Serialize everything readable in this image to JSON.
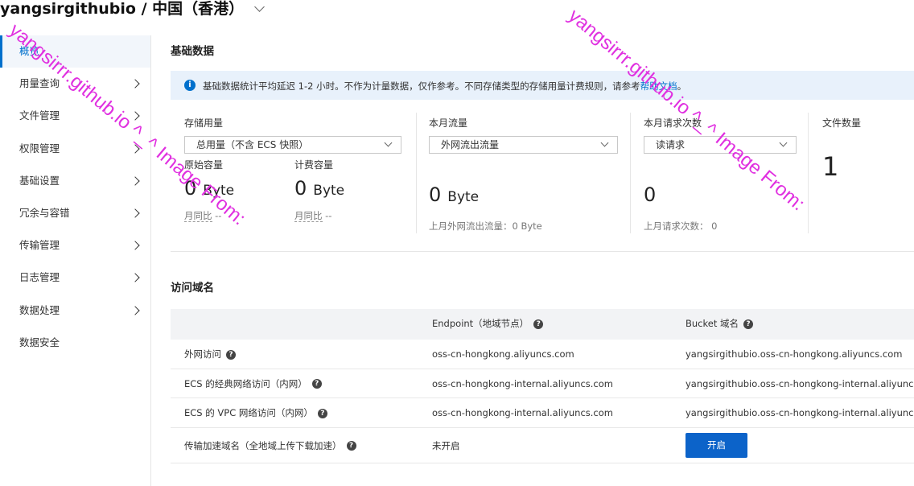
{
  "header": {
    "bucket": "yangsirgithubio",
    "region": "中国（香港）",
    "separator": " / "
  },
  "sidebar": {
    "items": [
      {
        "label": "概览",
        "active": true,
        "has_arrow": false
      },
      {
        "label": "用量查询",
        "has_arrow": true
      },
      {
        "label": "文件管理",
        "has_arrow": true
      },
      {
        "label": "权限管理",
        "has_arrow": true
      },
      {
        "label": "基础设置",
        "has_arrow": true
      },
      {
        "label": "冗余与容错",
        "has_arrow": true
      },
      {
        "label": "传输管理",
        "has_arrow": true
      },
      {
        "label": "日志管理",
        "has_arrow": true
      },
      {
        "label": "数据处理",
        "has_arrow": true
      },
      {
        "label": "数据安全",
        "has_arrow": false
      }
    ]
  },
  "basic": {
    "title": "基础数据",
    "info": {
      "text": "基础数据统计平均延迟 1-2 小时。不作为计量数据，仅作参考。不同存储类型的存储用量计费规则，请参考",
      "link": "帮助文档",
      "suffix": "。"
    },
    "storage": {
      "label": "存储用量",
      "select": "总用量（不含 ECS 快照）",
      "raw_label": "原始容量",
      "raw_value": "0",
      "raw_unit": "Byte",
      "raw_compare": "月同比",
      "raw_compare_value": "--",
      "billing_label": "计费容量",
      "billing_value": "0",
      "billing_unit": "Byte",
      "billing_compare": "月同比",
      "billing_compare_value": "--"
    },
    "traffic": {
      "label": "本月流量",
      "select": "外网流出流量",
      "value": "0",
      "unit": "Byte",
      "last_month": "上月外网流出流量：0 Byte"
    },
    "requests": {
      "label": "本月请求次数",
      "select": "读请求",
      "value": "0",
      "last_month": "上月请求次数： 0"
    },
    "files": {
      "label": "文件数量",
      "value": "1"
    }
  },
  "domains": {
    "title": "访问域名",
    "headers": [
      "",
      "Endpoint（地域节点）",
      "Bucket 域名"
    ],
    "rows": [
      {
        "name": "外网访问",
        "endpoint": "oss-cn-hongkong.aliyuncs.com",
        "bucket_domain": "yangsirgithubio.oss-cn-hongkong.aliyuncs.com"
      },
      {
        "name": "ECS 的经典网络访问（内网）",
        "endpoint": "oss-cn-hongkong-internal.aliyuncs.com",
        "bucket_domain": "yangsirgithubio.oss-cn-hongkong-internal.aliyuncs.com"
      },
      {
        "name": "ECS 的 VPC 网络访问（内网）",
        "endpoint": "oss-cn-hongkong-internal.aliyuncs.com",
        "bucket_domain": "yangsirgithubio.oss-cn-hongkong-internal.aliyuncs.com"
      },
      {
        "name": "传输加速域名（全地域上传下载加速）",
        "endpoint": "未开启",
        "button": "开启"
      }
    ]
  },
  "watermark": "yangsirrr.github.io ^_^ Image From:"
}
